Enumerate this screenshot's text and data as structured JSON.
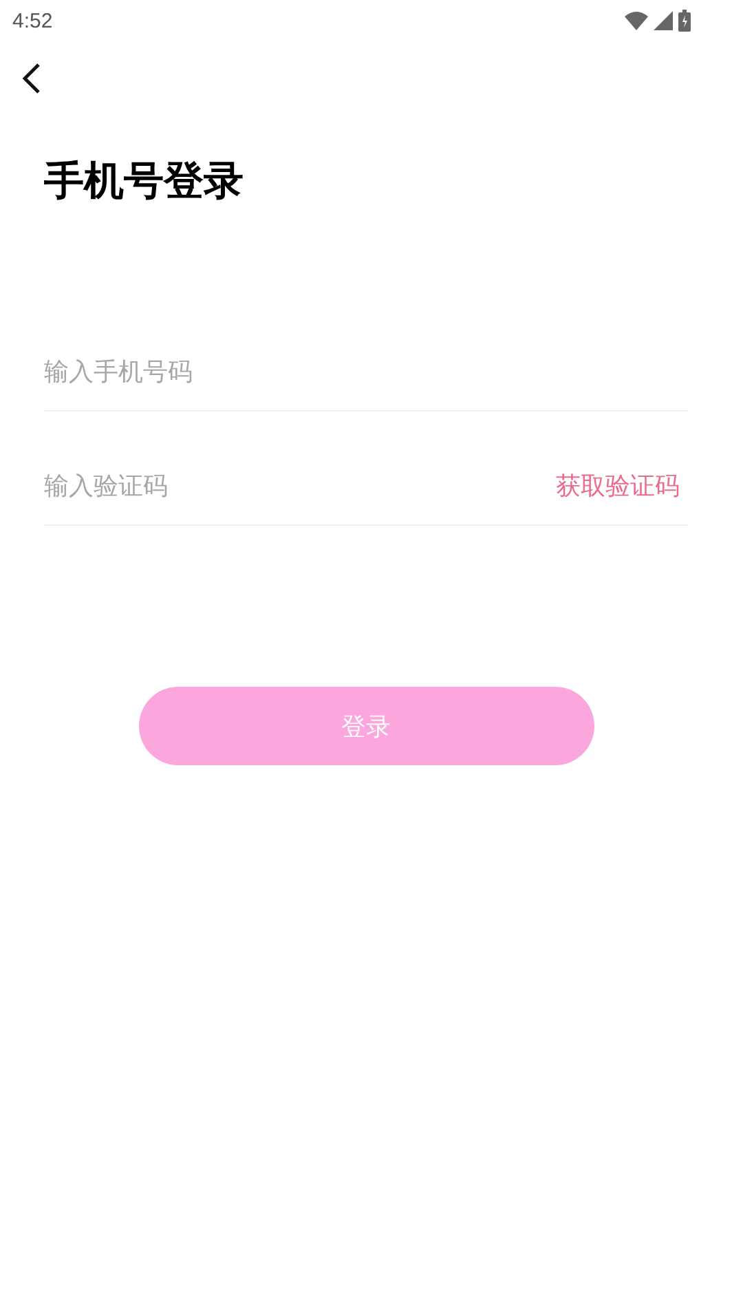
{
  "status_bar": {
    "time": "4:52"
  },
  "title": "手机号登录",
  "phone_field": {
    "placeholder": "输入手机号码"
  },
  "code_field": {
    "placeholder": "输入验证码",
    "action": "获取验证码"
  },
  "login_button": {
    "label": "登录",
    "disabled": true
  }
}
